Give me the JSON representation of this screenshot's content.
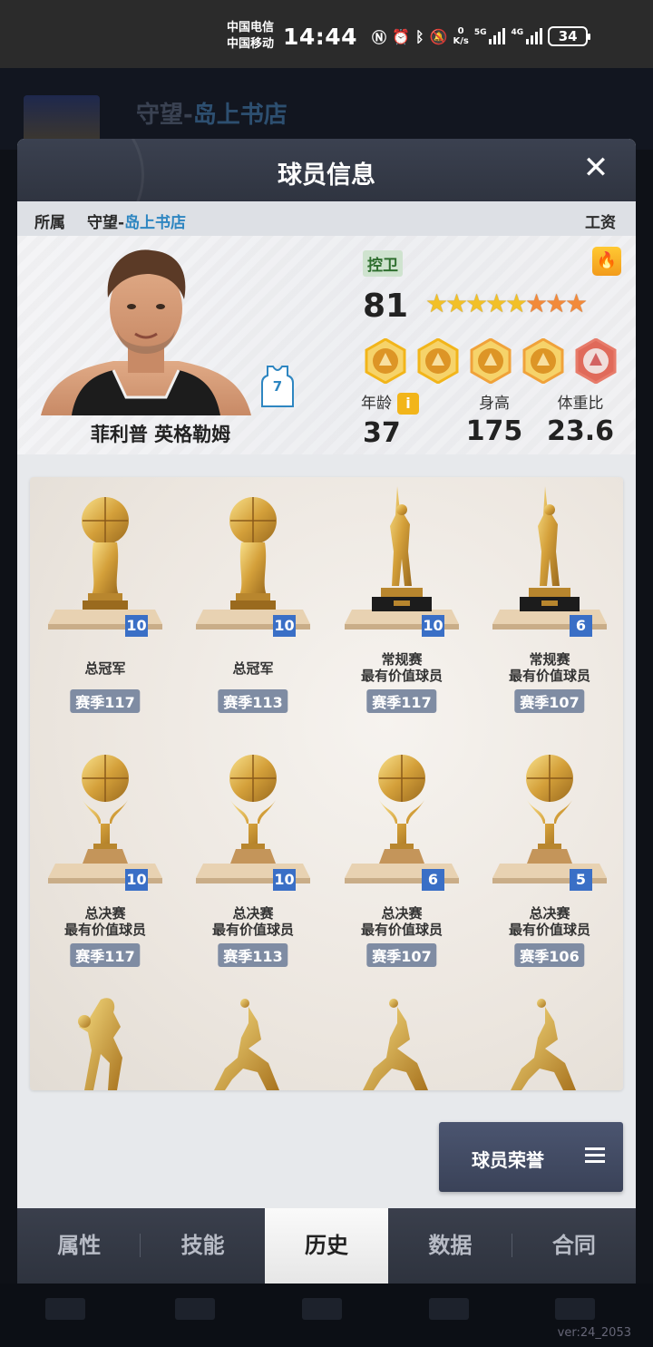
{
  "status_bar": {
    "carrier1": "中国电信",
    "carrier2": "中国移动",
    "time": "14:44",
    "net_speed_value": "0",
    "net_speed_unit": "K/s",
    "signal1_label": "5G",
    "signal2_label": "4G",
    "battery": "34"
  },
  "background": {
    "title_prefix": "守望-",
    "title_suffix": "岛上书店",
    "version": "ver:24_2053"
  },
  "modal": {
    "title": "球员信息",
    "close_label": "✕",
    "team_label": "所属",
    "team_prefix": "守望-",
    "team_store": "岛上书店",
    "salary_label": "工资"
  },
  "player": {
    "name": "菲利普 英格勒姆",
    "jersey_number": "7",
    "position": "控卫",
    "rating": "81",
    "stars_gold": 5,
    "stars_orange": 3,
    "badge_icons": [
      "post-badge-icon",
      "lightning-badge-icon",
      "shot-badge-icon",
      "defense-badge-icon",
      "wing-badge-icon"
    ],
    "attributes": {
      "age_label": "年龄",
      "age": "37",
      "info_icon": "i",
      "height_label": "身高",
      "height": "175",
      "weight_label": "体重比",
      "weight": "23.6"
    }
  },
  "trophies": [
    {
      "type": "ball",
      "count": "10",
      "name1": "总冠军",
      "name2": "",
      "season": "赛季117"
    },
    {
      "type": "ball",
      "count": "10",
      "name1": "总冠军",
      "name2": "",
      "season": "赛季113"
    },
    {
      "type": "figure",
      "count": "10",
      "name1": "常规赛",
      "name2": "最有价值球员",
      "season": "赛季117"
    },
    {
      "type": "figure",
      "count": "6",
      "name1": "常规赛",
      "name2": "最有价值球员",
      "season": "赛季107"
    },
    {
      "type": "ball2",
      "count": "10",
      "name1": "总决赛",
      "name2": "最有价值球员",
      "season": "赛季117"
    },
    {
      "type": "ball2",
      "count": "10",
      "name1": "总决赛",
      "name2": "最有价值球员",
      "season": "赛季113"
    },
    {
      "type": "ball2",
      "count": "6",
      "name1": "总决赛",
      "name2": "最有价值球员",
      "season": "赛季107"
    },
    {
      "type": "ball2",
      "count": "5",
      "name1": "总决赛",
      "name2": "最有价值球员",
      "season": "赛季106"
    }
  ],
  "honors_button": "球员荣誉",
  "tabs": [
    {
      "label": "属性",
      "active": false
    },
    {
      "label": "技能",
      "active": false
    },
    {
      "label": "历史",
      "active": true
    },
    {
      "label": "数据",
      "active": false
    },
    {
      "label": "合同",
      "active": false
    }
  ]
}
